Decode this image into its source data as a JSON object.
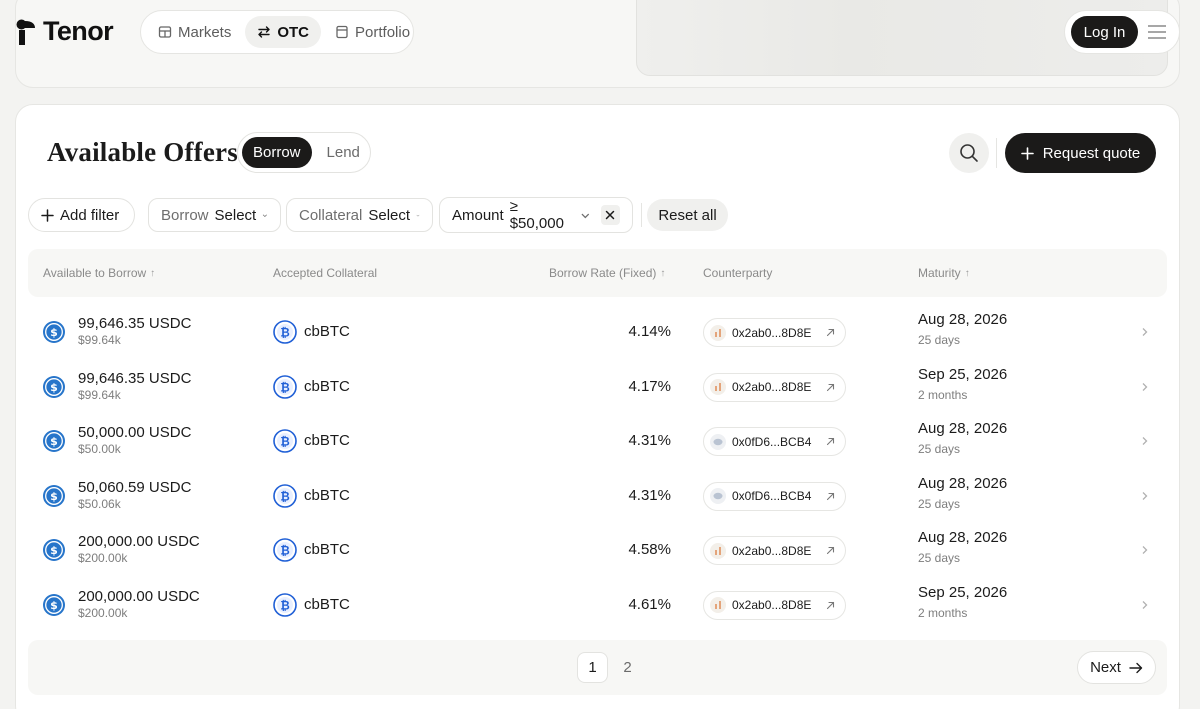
{
  "brand": {
    "name": "Tenor"
  },
  "nav": {
    "items": [
      {
        "label": "Markets",
        "icon": "markets-icon",
        "active": false
      },
      {
        "label": "OTC",
        "icon": "swap-icon",
        "active": true
      },
      {
        "label": "Portfolio",
        "icon": "portfolio-icon",
        "active": false
      }
    ],
    "login_label": "Log In"
  },
  "page": {
    "title": "Available Offers",
    "toggle": {
      "options": [
        "Borrow",
        "Lend"
      ],
      "selected": "Borrow"
    },
    "request_quote_label": "Request quote"
  },
  "filters": {
    "add_filter_label": "Add filter",
    "borrow": {
      "label": "Borrow",
      "value": "Select"
    },
    "collateral": {
      "label": "Collateral",
      "value": "Select"
    },
    "amount": {
      "label": "Amount",
      "value": "≥ $50,000"
    },
    "reset_label": "Reset all"
  },
  "table": {
    "headers": {
      "available": "Available to Borrow",
      "collateral": "Accepted Collateral",
      "rate": "Borrow Rate (Fixed)",
      "counterparty": "Counterparty",
      "maturity": "Maturity",
      "sort_glyph": "↑"
    },
    "rows": [
      {
        "amount": "99,646.35 USDC",
        "amount_usd": "$99.64k",
        "collateral": "cbBTC",
        "rate": "4.14%",
        "counterparty": "0x2ab0...8D8E",
        "cp_variant": "a",
        "maturity": "Aug 28, 2026",
        "maturity_rel": "25 days"
      },
      {
        "amount": "99,646.35 USDC",
        "amount_usd": "$99.64k",
        "collateral": "cbBTC",
        "rate": "4.17%",
        "counterparty": "0x2ab0...8D8E",
        "cp_variant": "a",
        "maturity": "Sep 25, 2026",
        "maturity_rel": "2 months"
      },
      {
        "amount": "50,000.00 USDC",
        "amount_usd": "$50.00k",
        "collateral": "cbBTC",
        "rate": "4.31%",
        "counterparty": "0x0fD6...BCB4",
        "cp_variant": "b",
        "maturity": "Aug 28, 2026",
        "maturity_rel": "25 days"
      },
      {
        "amount": "50,060.59 USDC",
        "amount_usd": "$50.06k",
        "collateral": "cbBTC",
        "rate": "4.31%",
        "counterparty": "0x0fD6...BCB4",
        "cp_variant": "b",
        "maturity": "Aug 28, 2026",
        "maturity_rel": "25 days"
      },
      {
        "amount": "200,000.00 USDC",
        "amount_usd": "$200.00k",
        "collateral": "cbBTC",
        "rate": "4.58%",
        "counterparty": "0x2ab0...8D8E",
        "cp_variant": "a",
        "maturity": "Aug 28, 2026",
        "maturity_rel": "25 days"
      },
      {
        "amount": "200,000.00 USDC",
        "amount_usd": "$200.00k",
        "collateral": "cbBTC",
        "rate": "4.61%",
        "counterparty": "0x2ab0...8D8E",
        "cp_variant": "a",
        "maturity": "Sep 25, 2026",
        "maturity_rel": "2 months"
      }
    ]
  },
  "pagination": {
    "pages": [
      "1",
      "2"
    ],
    "current": "1",
    "next_label": "Next"
  },
  "colors": {
    "accent_dark": "#1b1a19",
    "usdc_blue": "#2775ca",
    "btc_blue": "#1f5fd6"
  }
}
